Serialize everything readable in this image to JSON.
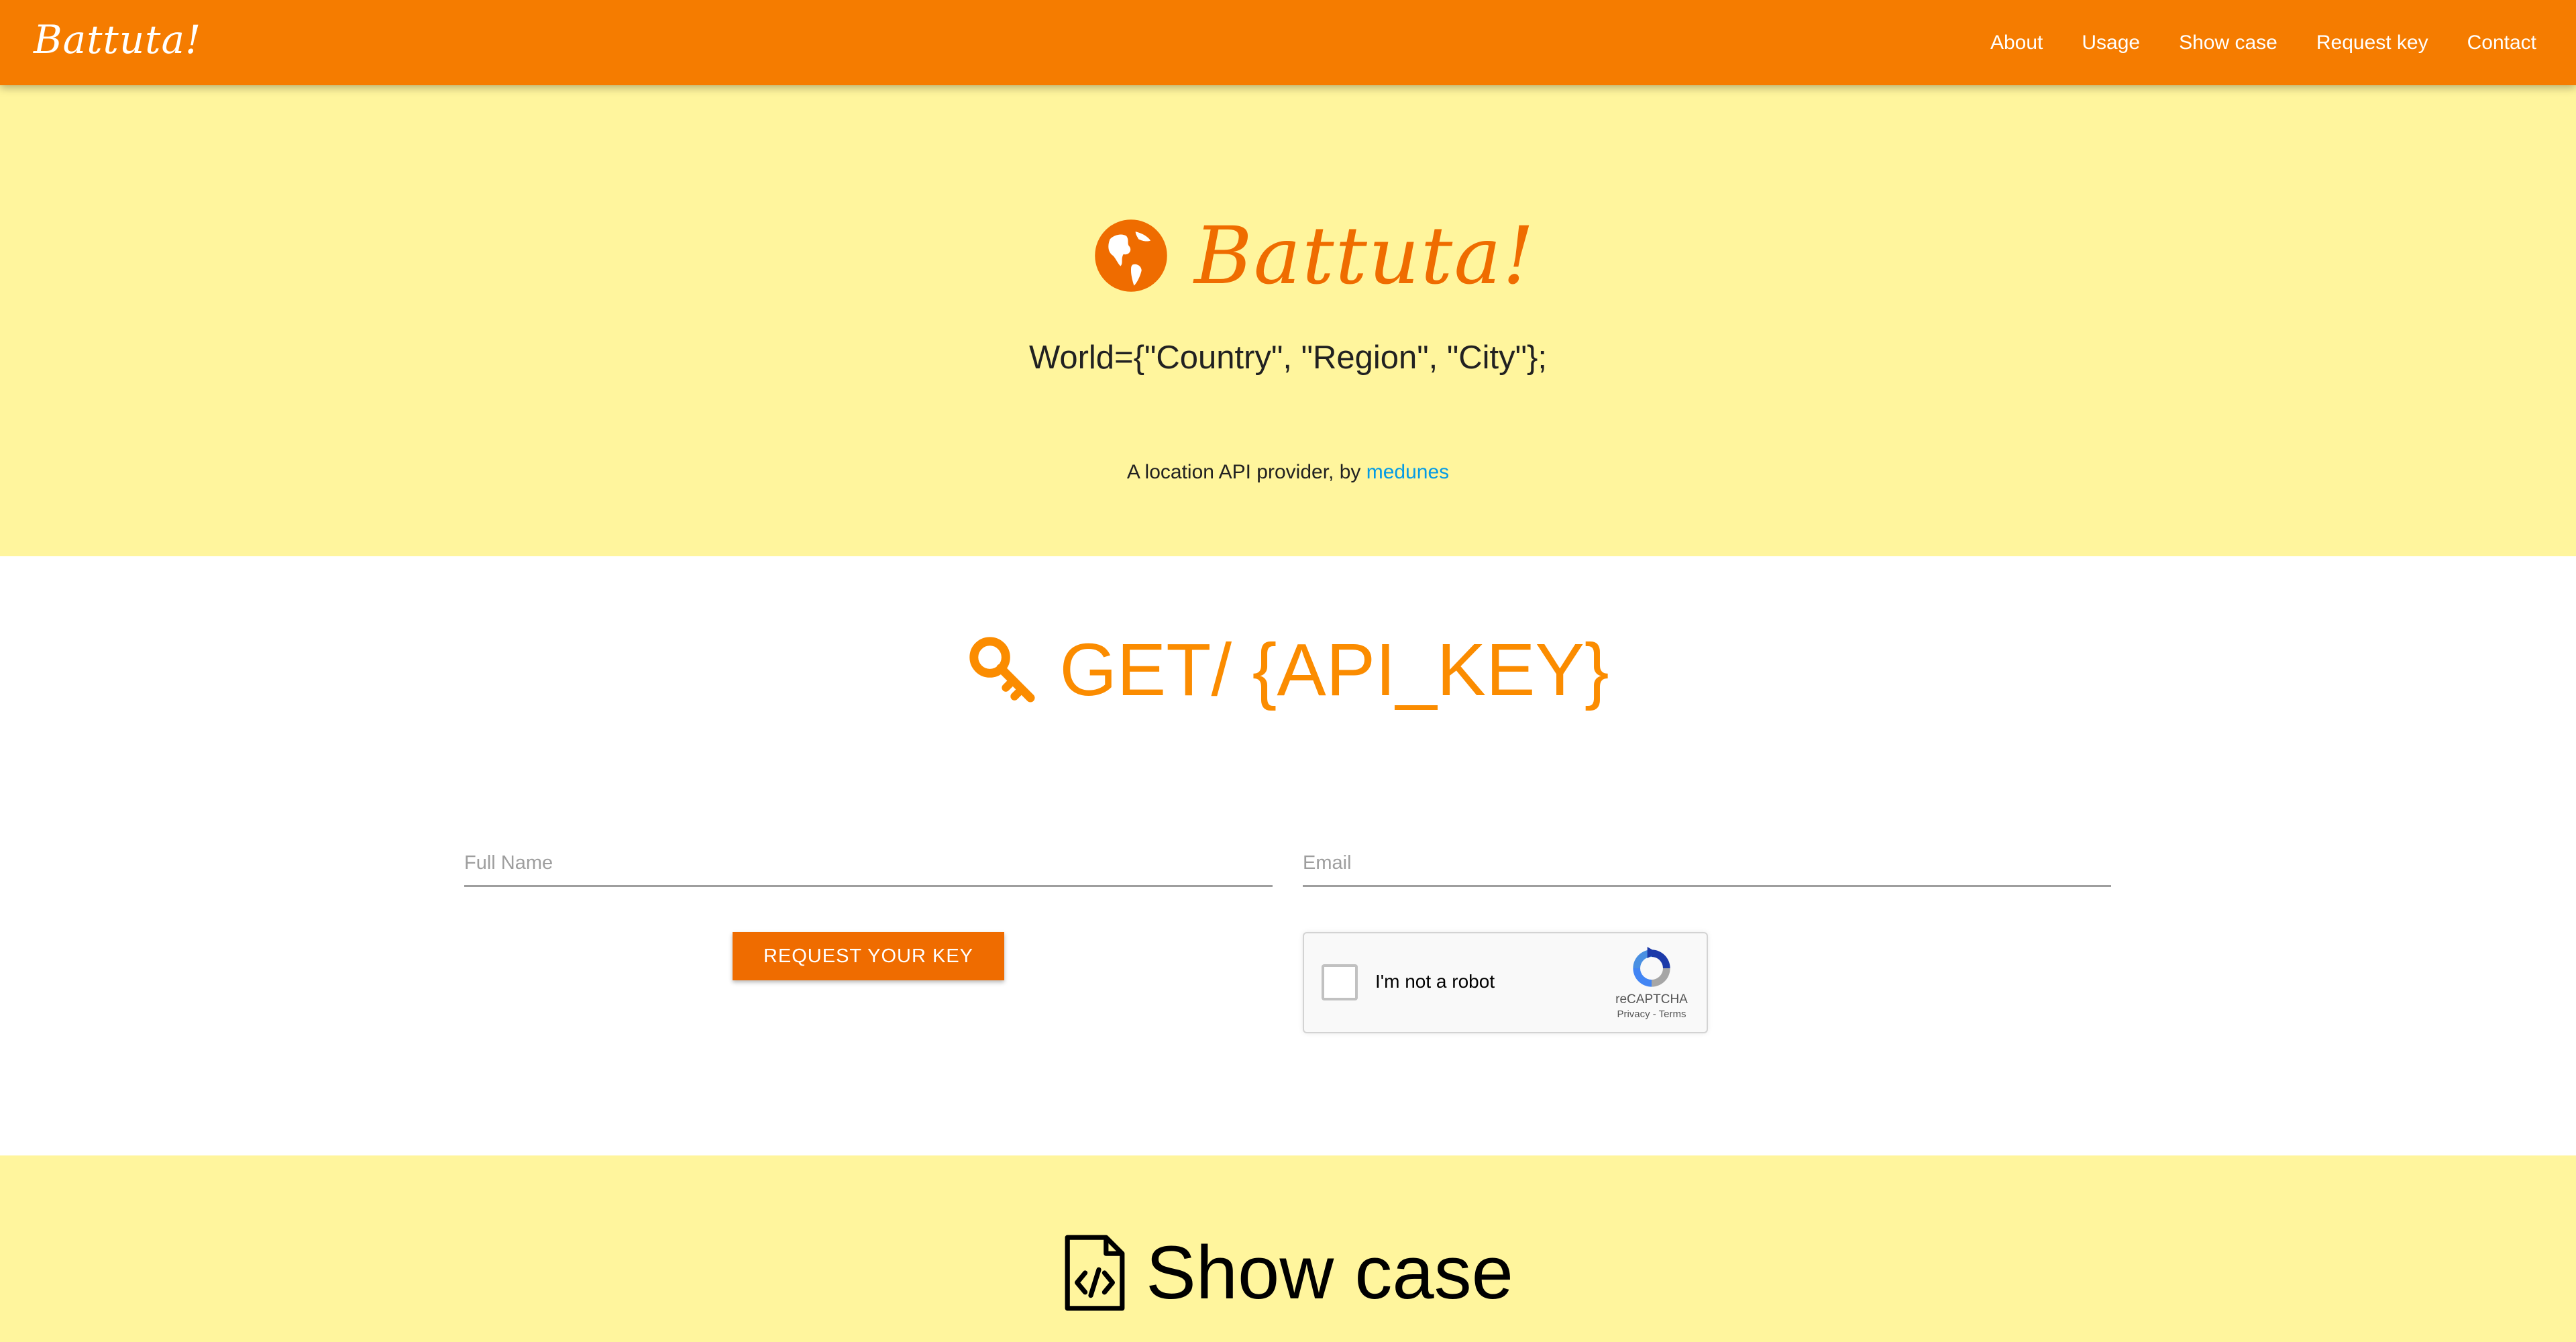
{
  "navbar": {
    "brand": "Battuta!",
    "links": [
      "About",
      "Usage",
      "Show case",
      "Request key",
      "Contact"
    ],
    "background": "#f57c00"
  },
  "hero": {
    "icon": "globe-icon",
    "title": "Battuta!",
    "tagline": "World={\"Country\", \"Region\", \"City\"};",
    "subtitle_prefix": "A location API provider, by ",
    "subtitle_link": "medunes",
    "background": "#fff59d",
    "link_color": "#039be5"
  },
  "request_key": {
    "icon": "key-icon",
    "heading": "GET/ {API_KEY}",
    "heading_color": "#fb8c00",
    "full_name_placeholder": "Full Name",
    "email_placeholder": "Email",
    "button_label": "REQUEST YOUR KEY",
    "button_color": "#ef6c00",
    "recaptcha": {
      "label": "I'm not a robot",
      "brand": "reCAPTCHA",
      "links": "Privacy - Terms"
    }
  },
  "showcase": {
    "icon": "code-file-icon",
    "heading": "Show case"
  }
}
